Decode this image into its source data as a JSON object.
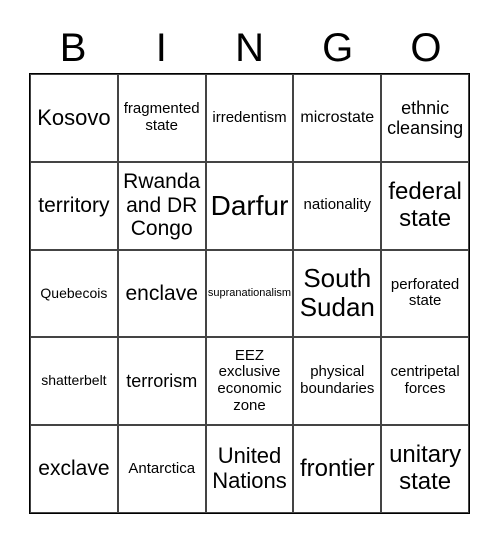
{
  "header": {
    "letters": [
      "B",
      "I",
      "N",
      "G",
      "O"
    ]
  },
  "grid": {
    "rows": [
      [
        "Kosovo",
        "fragmented state",
        "irredentism",
        "microstate",
        "ethnic cleansing"
      ],
      [
        "territory",
        "Rwanda and DR Congo",
        "Darfur",
        "nationality",
        "federal state"
      ],
      [
        "Quebecois",
        "enclave",
        "supranationalism",
        "South Sudan",
        "perforated state"
      ],
      [
        "shatterbelt",
        "terrorism",
        "EEZ exclusive economic zone",
        "physical boundaries",
        "centripetal forces"
      ],
      [
        "exclave",
        "Antarctica",
        "United Nations",
        "frontier",
        "unitary state"
      ]
    ]
  }
}
